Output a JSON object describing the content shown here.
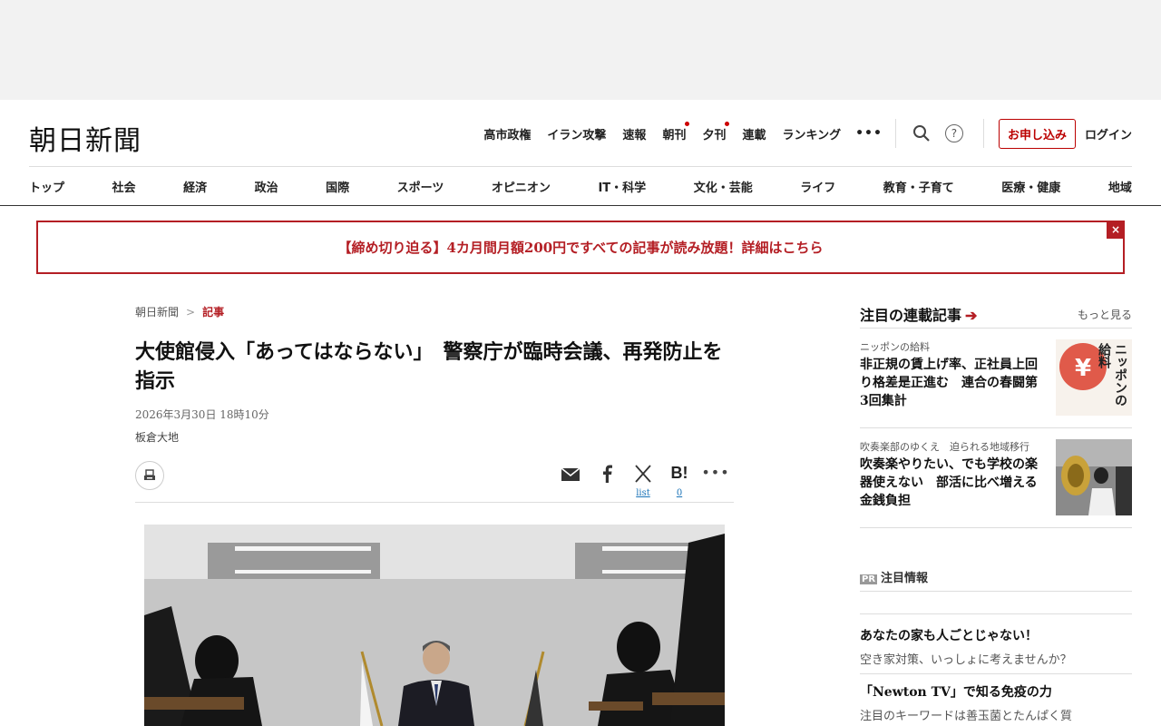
{
  "header": {
    "logo": "朝日新聞",
    "top_links": [
      {
        "label": "高市政権",
        "dot": false
      },
      {
        "label": "イラン攻撃",
        "dot": false
      },
      {
        "label": "速報",
        "dot": false
      },
      {
        "label": "朝刊",
        "dot": true
      },
      {
        "label": "夕刊",
        "dot": true
      },
      {
        "label": "連載",
        "dot": false
      },
      {
        "label": "ランキング",
        "dot": false
      }
    ],
    "more": "•••",
    "help": "?",
    "subscribe": "お申し込み",
    "login": "ログイン"
  },
  "nav": [
    "トップ",
    "社会",
    "経済",
    "政治",
    "国際",
    "スポーツ",
    "オピニオン",
    "IT・科学",
    "文化・芸能",
    "ライフ",
    "教育・子育て",
    "医療・健康",
    "地域"
  ],
  "promo": {
    "text": "【締め切り迫る】4カ月間月額200円ですべての記事が読み放題！詳細はこちら",
    "close": "×"
  },
  "article": {
    "breadcrumb": {
      "home": "朝日新聞",
      "sep": ">",
      "current": "記事"
    },
    "headline": "大使館侵入「あってはならない」　警察庁が臨時会議、再発防止を指示",
    "date": "2026年3月30日 18時10分",
    "author": "板倉大地",
    "share": {
      "x_count": "list",
      "hatena_count": "0",
      "hatena_label": "B!",
      "more": "•••"
    }
  },
  "sidebar": {
    "title": "注目の連載記事",
    "more": "もっと見る",
    "items": [
      {
        "kicker": "ニッポンの給料",
        "title": "非正規の賃上げ率、正社員上回り格差是正進む　連合の春闘第3回集計",
        "thumb_text": "ニッポンの給料"
      },
      {
        "kicker": "吹奏楽部のゆくえ　迫られる地域移行",
        "title": "吹奏楽やりたい、でも学校の楽器使えない　部活に比べ増える金銭負担"
      }
    ]
  },
  "pr": {
    "badge": "PR",
    "title": "注目情報",
    "items": [
      {
        "title": "あなたの家も人ごとじゃない！",
        "sub": "空き家対策、いっしょに考えませんか？"
      },
      {
        "title": "「Newton TV」で知る免疫の力",
        "sub": "注目のキーワードは善玉菌とたんぱく質"
      }
    ]
  },
  "colors": {
    "accent": "#b41e24"
  }
}
